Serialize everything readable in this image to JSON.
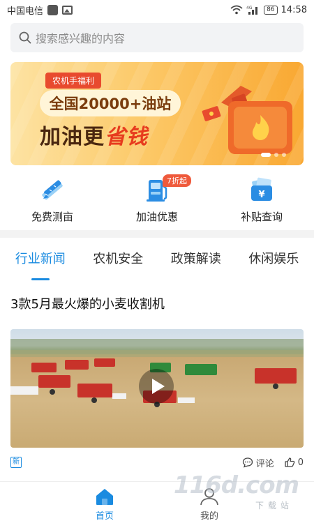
{
  "status_bar": {
    "carrier": "中国电信",
    "battery": "86",
    "time": "14:58"
  },
  "search": {
    "placeholder": "搜索感兴趣的内容"
  },
  "banner": {
    "tag": "农机手福利",
    "pill": "全国20000+油站",
    "headline_prefix": "加油更",
    "headline_highlight": "省钱",
    "slides": 3,
    "active_slide": 1
  },
  "quick_entries": [
    {
      "label": "免费测亩",
      "icon": "ruler-pencil-icon"
    },
    {
      "label": "加油优惠",
      "icon": "fuel-pump-icon",
      "badge": "7折起"
    },
    {
      "label": "补贴查询",
      "icon": "yuan-wallet-icon"
    }
  ],
  "tabs": [
    {
      "label": "行业新闻",
      "active": true
    },
    {
      "label": "农机安全",
      "active": false
    },
    {
      "label": "政策解读",
      "active": false
    },
    {
      "label": "休闲娱乐",
      "active": false
    }
  ],
  "article": {
    "title": "3款5月最火爆的小麦收割机",
    "tag": "新",
    "comment_label": "评论",
    "like_count": "0"
  },
  "bottom_nav": [
    {
      "label": "首页",
      "icon": "home-icon",
      "active": true
    },
    {
      "label": "我的",
      "icon": "user-icon",
      "active": false
    }
  ],
  "watermark": {
    "brand": "116d.com",
    "sub": "下载站"
  },
  "colors": {
    "accent": "#1a8be0",
    "banner_red": "#e73b1e",
    "badge": "#ef5a3c"
  }
}
